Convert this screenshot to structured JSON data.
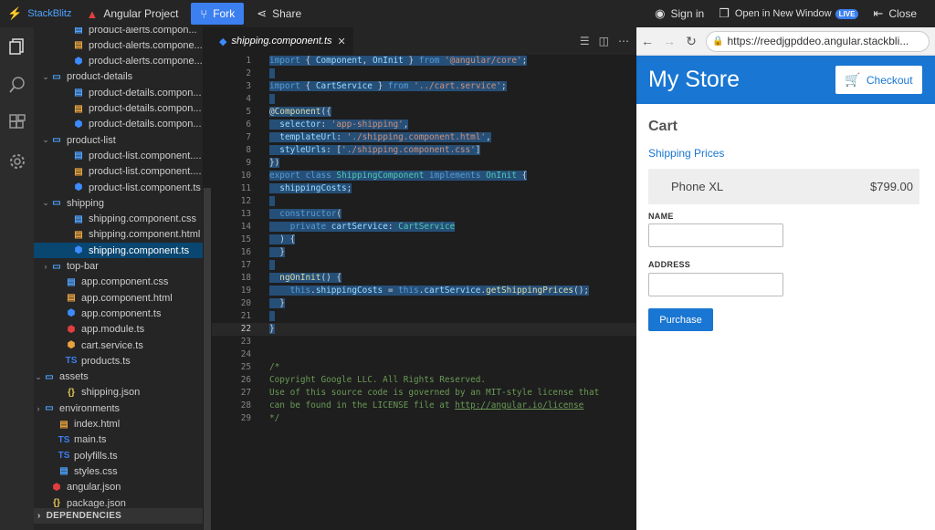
{
  "topbar": {
    "brand": "StackBlitz",
    "project": "Angular Project",
    "fork": "Fork",
    "share": "Share",
    "signin": "Sign in",
    "open_new_window": "Open in New Window",
    "live": "LIVE",
    "close": "Close"
  },
  "explorer": {
    "rows": [
      {
        "label": "product-alerts.compon...",
        "icon": "css-file-icon"
      },
      {
        "label": "product-alerts.compone...",
        "icon": "html-file-icon"
      },
      {
        "label": "product-alerts.compone...",
        "icon": "angular-file-icon"
      },
      {
        "label": "product-details",
        "icon": "folder-icon"
      },
      {
        "label": "product-details.compon...",
        "icon": "css-file-icon"
      },
      {
        "label": "product-details.compon...",
        "icon": "html-file-icon"
      },
      {
        "label": "product-details.compon...",
        "icon": "angular-file-icon"
      },
      {
        "label": "product-list",
        "icon": "folder-icon"
      },
      {
        "label": "product-list.component....",
        "icon": "css-file-icon"
      },
      {
        "label": "product-list.component....",
        "icon": "html-file-icon"
      },
      {
        "label": "product-list.component.ts",
        "icon": "angular-file-icon"
      },
      {
        "label": "shipping",
        "icon": "folder-icon"
      },
      {
        "label": "shipping.component.css",
        "icon": "css-file-icon"
      },
      {
        "label": "shipping.component.html",
        "icon": "html-file-icon"
      },
      {
        "label": "shipping.component.ts",
        "icon": "angular-file-icon"
      },
      {
        "label": "top-bar",
        "icon": "folder-icon"
      },
      {
        "label": "app.component.css",
        "icon": "css-file-icon"
      },
      {
        "label": "app.component.html",
        "icon": "html-file-icon"
      },
      {
        "label": "app.component.ts",
        "icon": "angular-file-icon"
      },
      {
        "label": "app.module.ts",
        "icon": "angular-module-icon"
      },
      {
        "label": "cart.service.ts",
        "icon": "angular-service-icon"
      },
      {
        "label": "products.ts",
        "icon": "ts-file-icon"
      },
      {
        "label": "assets",
        "icon": "folder-icon"
      },
      {
        "label": "shipping.json",
        "icon": "json-file-icon"
      },
      {
        "label": "environments",
        "icon": "folder-icon"
      },
      {
        "label": "index.html",
        "icon": "html-file-icon"
      },
      {
        "label": "main.ts",
        "icon": "ts-file-icon"
      },
      {
        "label": "polyfills.ts",
        "icon": "ts-file-icon"
      },
      {
        "label": "styles.css",
        "icon": "css-file-icon"
      },
      {
        "label": "angular.json",
        "icon": "angular-json-icon"
      },
      {
        "label": "package.json",
        "icon": "json-file-icon"
      }
    ],
    "dependencies": "DEPENDENCIES"
  },
  "editor": {
    "tab": "shipping.component.ts",
    "line_numbers": [
      "1",
      "2",
      "3",
      "4",
      "5",
      "6",
      "7",
      "8",
      "9",
      "10",
      "11",
      "12",
      "13",
      "14",
      "15",
      "16",
      "17",
      "18",
      "19",
      "20",
      "21",
      "22",
      "23",
      "24",
      "25",
      "26",
      "27",
      "28",
      "29"
    ]
  },
  "browser": {
    "url": "https://reedjgpddeo.angular.stackbli...",
    "store_title": "My Store",
    "checkout": "Checkout",
    "cart_title": "Cart",
    "shipping_link": "Shipping Prices",
    "item_name": "Phone XL",
    "item_price": "$799.00",
    "name_label": "NAME",
    "address_label": "ADDRESS",
    "purchase": "Purchase"
  }
}
